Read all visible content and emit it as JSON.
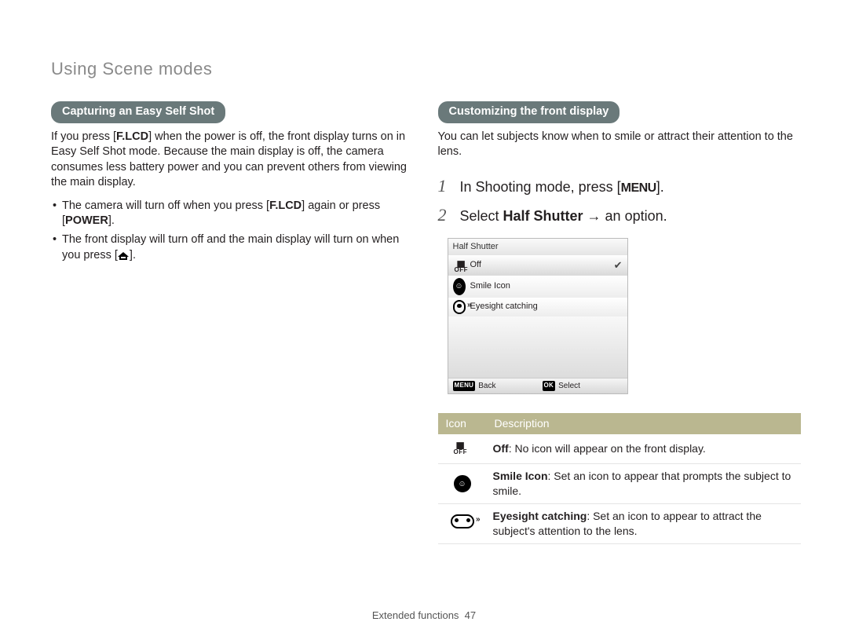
{
  "chapter_title": "Using Scene modes",
  "left": {
    "pill": "Capturing an Easy Self Shot",
    "intro_a": "If you press [",
    "intro_b": "] when the power is off, the front display turns on in Easy Self Shot mode. Because the main display is off, the camera consumes less battery power and you can prevent others from viewing the main display.",
    "flcd": "F.LCD",
    "bullet1_a": "The camera will turn off when you press [",
    "bullet1_b": "] again or press [",
    "bullet1_c": "].",
    "power": "POWER",
    "bullet2_a": "The front display will turn off and the main display will turn on when you press [",
    "bullet2_b": "]."
  },
  "right": {
    "pill": "Customizing the front display",
    "intro": "You can let subjects know when to smile or attract their attention to the lens.",
    "step1_a": "In Shooting mode, press [",
    "step1_menu": "MENU",
    "step1_b": "].",
    "step2_a": "Select ",
    "step2_b": "Half Shutter",
    "step2_c": " → an option.",
    "ui": {
      "title": "Half Shutter",
      "opt_off": "Off",
      "opt_smile": "Smile Icon",
      "opt_eyes": "Eyesight catching",
      "back_label": "Back",
      "select_label": "Select",
      "menu_badge": "MENU",
      "ok_badge": "OK"
    },
    "table": {
      "head_icon": "Icon",
      "head_desc": "Description",
      "row1_b": "Off",
      "row1_t": ": No icon will appear on the front display.",
      "row2_b": "Smile Icon",
      "row2_t": ": Set an icon to appear that prompts the subject to smile.",
      "row3_b": "Eyesight catching",
      "row3_t": ": Set an icon to appear to attract the subject's attention to the lens."
    }
  },
  "footer_text": "Extended functions",
  "page_number": "47",
  "off_txt": "OFF"
}
